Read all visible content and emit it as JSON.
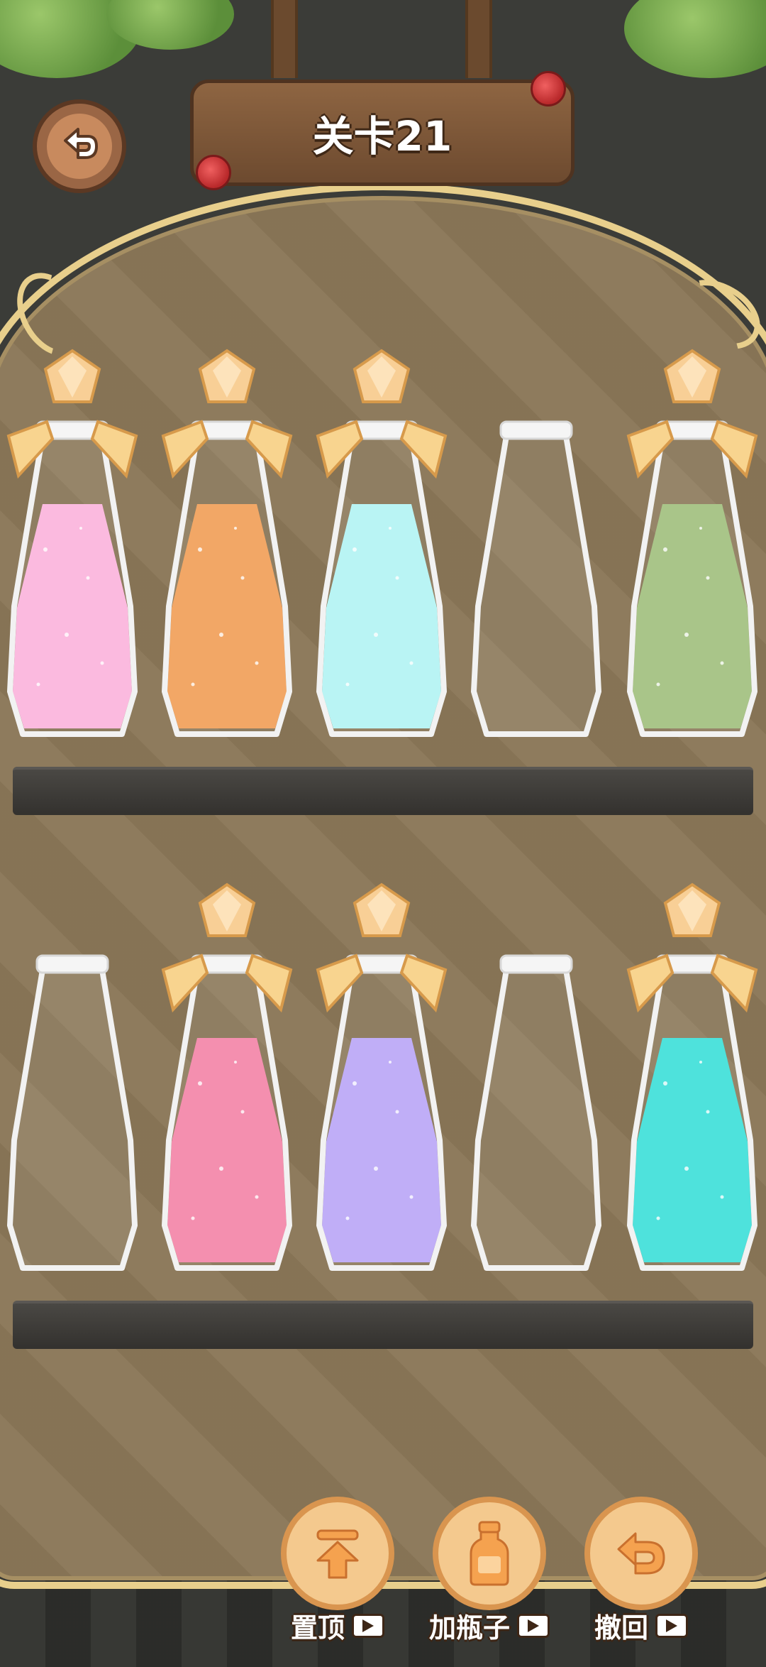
{
  "level": {
    "title": "关卡21"
  },
  "colors": {
    "pink": "#fbb5dd",
    "orange": "#f1a05a",
    "light_cyan": "#b4f3f3",
    "green": "#a2c07f",
    "rose": "#f386a9",
    "lavender": "#bba8f7",
    "teal": "#3fe0da",
    "empty": "none"
  },
  "shelves": [
    {
      "bottles": [
        {
          "color": "pink",
          "capped": true
        },
        {
          "color": "orange",
          "capped": true
        },
        {
          "color": "light_cyan",
          "capped": true
        },
        {
          "color": "empty",
          "capped": false
        },
        {
          "color": "green",
          "capped": true
        }
      ]
    },
    {
      "bottles": [
        {
          "color": "empty",
          "capped": false
        },
        {
          "color": "rose",
          "capped": true
        },
        {
          "color": "lavender",
          "capped": true
        },
        {
          "color": "empty",
          "capped": false
        },
        {
          "color": "teal",
          "capped": true
        }
      ]
    }
  ],
  "toolbar": {
    "pin_top": {
      "label": "置顶",
      "icon": "arrow-to-top-icon"
    },
    "add_bottle": {
      "label": "加瓶子",
      "icon": "bottle-icon"
    },
    "undo": {
      "label": "撤回",
      "icon": "undo-arrow-icon"
    }
  }
}
